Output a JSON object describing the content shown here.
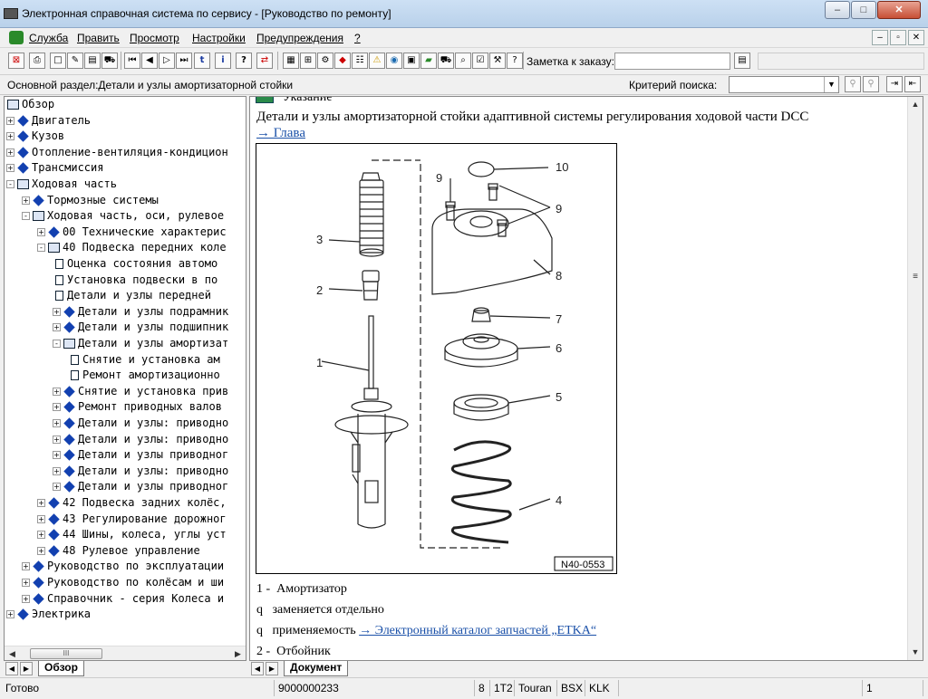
{
  "window": {
    "title": "Электронная справочная система по сервису - [Руководство по ремонту]"
  },
  "menu": {
    "items": [
      "Служба",
      "Править",
      "Просмотр",
      "Настройки",
      "Предупреждения",
      "?"
    ]
  },
  "toolbar": {
    "note_label": "Заметка к заказу:",
    "note_value": ""
  },
  "section": {
    "label": "Основной раздел:Детали и узлы амортизаторной стойки",
    "criteria_label": "Критерий  поиска:",
    "criteria_value": ""
  },
  "tree": [
    {
      "text": "Обзор",
      "icon": "open-book",
      "exp": "",
      "level": 0
    },
    {
      "text": "Двигатель",
      "icon": "book",
      "exp": "+",
      "level": 0
    },
    {
      "text": "Кузов",
      "icon": "book",
      "exp": "+",
      "level": 0
    },
    {
      "text": "Отопление-вентиляция-кондицион",
      "icon": "book",
      "exp": "+",
      "level": 0
    },
    {
      "text": "Трансмиссия",
      "icon": "book",
      "exp": "+",
      "level": 0
    },
    {
      "text": "Ходовая часть",
      "icon": "open-book",
      "exp": "-",
      "level": 0
    },
    {
      "text": "Тормозные системы",
      "icon": "book",
      "exp": "+",
      "level": 1
    },
    {
      "text": "Ходовая часть, оси, рулевое",
      "icon": "open-book",
      "exp": "-",
      "level": 1
    },
    {
      "text": "00 Технические характерис",
      "icon": "book",
      "exp": "+",
      "level": 2
    },
    {
      "text": "40 Подвеска передних коле",
      "icon": "open-book",
      "exp": "-",
      "level": 2
    },
    {
      "text": "Оценка состояния автомо",
      "icon": "document",
      "exp": "",
      "level": 3
    },
    {
      "text": "Установка подвески в по",
      "icon": "document",
      "exp": "",
      "level": 3
    },
    {
      "text": "Детали и узлы передней",
      "icon": "document",
      "exp": "",
      "level": 3
    },
    {
      "text": "Детали и узлы подрамник",
      "icon": "book",
      "exp": "+",
      "level": 3
    },
    {
      "text": "Детали и узлы подшипник",
      "icon": "book",
      "exp": "+",
      "level": 3
    },
    {
      "text": "Детали и узлы амортизат",
      "icon": "open-book",
      "exp": "-",
      "level": 3
    },
    {
      "text": "Снятие и установка ам",
      "icon": "document",
      "exp": "",
      "level": 4
    },
    {
      "text": "Ремонт амортизационно",
      "icon": "document",
      "exp": "",
      "level": 4
    },
    {
      "text": "Снятие и установка прив",
      "icon": "book",
      "exp": "+",
      "level": 3
    },
    {
      "text": "Ремонт приводных валов",
      "icon": "book",
      "exp": "+",
      "level": 3
    },
    {
      "text": "Детали и узлы: приводно",
      "icon": "book",
      "exp": "+",
      "level": 3
    },
    {
      "text": "Детали и узлы: приводно",
      "icon": "book",
      "exp": "+",
      "level": 3
    },
    {
      "text": "Детали и узлы приводног",
      "icon": "book",
      "exp": "+",
      "level": 3
    },
    {
      "text": "Детали и узлы: приводно",
      "icon": "book",
      "exp": "+",
      "level": 3
    },
    {
      "text": "Детали и узлы приводног",
      "icon": "book",
      "exp": "+",
      "level": 3
    },
    {
      "text": "42 Подвеска задних колёс,",
      "icon": "book",
      "exp": "+",
      "level": 2
    },
    {
      "text": "43 Регулирование дорожног",
      "icon": "book",
      "exp": "+",
      "level": 2
    },
    {
      "text": "44 Шины, колеса, углы уст",
      "icon": "book",
      "exp": "+",
      "level": 2
    },
    {
      "text": "48 Рулевое управление",
      "icon": "book",
      "exp": "+",
      "level": 2
    },
    {
      "text": "Руководство по эксплуатации",
      "icon": "book",
      "exp": "+",
      "level": 1
    },
    {
      "text": "Руководство по колёсам и ши",
      "icon": "book",
      "exp": "+",
      "level": 1
    },
    {
      "text": "Справочник - серия Колеса и",
      "icon": "book",
      "exp": "+",
      "level": 1
    },
    {
      "text": "Электрика",
      "icon": "book",
      "exp": "+",
      "level": 0
    }
  ],
  "left_tab": {
    "label": "Обзор",
    "scroll_thumb": "III"
  },
  "content": {
    "notice": "Указание",
    "heading": "Детали и узлы амортизаторной стойки адаптивной системы регулирования ходовой части DCC",
    "chapter_link": "→ Глава",
    "figure_code": "N40-0553",
    "callouts": [
      "1",
      "2",
      "3",
      "4",
      "5",
      "6",
      "7",
      "8",
      "9",
      "9",
      "10"
    ],
    "legend": [
      {
        "num": "1 -",
        "text": "Амортизатор"
      },
      {
        "num": "q",
        "text": "заменяется отдельно"
      },
      {
        "num": "q",
        "text": "применяемость ",
        "link": "→ Электронный каталог запчастей „ETKA“"
      },
      {
        "num": "2 -",
        "text": "Отбойник"
      }
    ]
  },
  "right_tab": {
    "label": "Документ"
  },
  "status": {
    "ready": "Готово",
    "code": "9000000233",
    "f1": "8",
    "f2": "1T2",
    "model": "Touran",
    "f3": "BSX",
    "f4": "KLK",
    "page": "1"
  }
}
